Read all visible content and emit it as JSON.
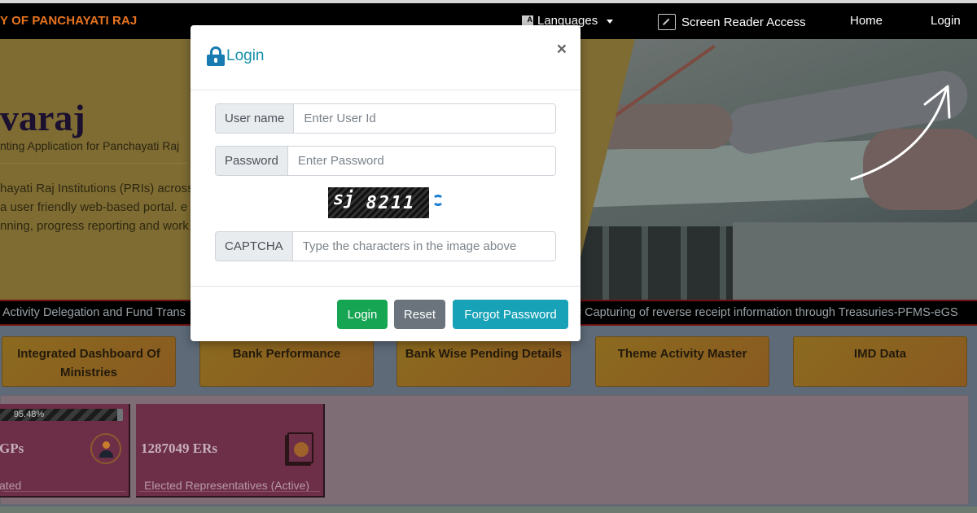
{
  "navbar": {
    "brand": "Y OF PANCHAYATI RAJ",
    "items": [
      {
        "label": "Languages",
        "icon": "language-icon",
        "has_dropdown": true
      },
      {
        "label": "Screen Reader Access",
        "icon": "screen-reader-icon"
      },
      {
        "label": "Home"
      },
      {
        "label": "Login"
      }
    ]
  },
  "hero": {
    "title": "varaj",
    "subtitle": "nting Application for Panchayati Raj",
    "description": "hayati Raj Institutions (PRIs) across\na user friendly web-based portal. e\nnning, progress reporting and work"
  },
  "ticker": {
    "items": [
      "Activity Delegation and Fund Trans",
      "# Capturing of reverse receipt information through Treasuries-PFMS-eGS"
    ]
  },
  "quick_links": [
    {
      "label": "Integrated Dashboard Of Ministries"
    },
    {
      "label": "Bank Performance"
    },
    {
      "label": "Bank Wise Pending Details"
    },
    {
      "label": "Theme Activity Master"
    },
    {
      "label": "IMD Data"
    }
  ],
  "stats": [
    {
      "progress_percent": 95.48,
      "progress_label": "95.48%",
      "value": "GPs",
      "label": "ated",
      "icon": "gram-panchayat-icon"
    },
    {
      "value": "1287049 ERs",
      "label": "Elected Representatives (Active)",
      "icon": "elected-representative-icon"
    }
  ],
  "login_modal": {
    "title": "Login",
    "close_symbol": "×",
    "username": {
      "label": "User name",
      "placeholder": "Enter User Id",
      "value": ""
    },
    "password": {
      "label": "Password",
      "placeholder": "Enter Password",
      "value": ""
    },
    "captcha": {
      "image_text_1": "sj",
      "image_text_2": "8211",
      "label": "CAPTCHA",
      "placeholder": "Type the characters in the image above",
      "value": ""
    },
    "buttons": {
      "login": "Login",
      "reset": "Reset",
      "forgot_password": "Forgot Password"
    },
    "colors": {
      "title": "#1690a8",
      "login_button": "#16a553",
      "reset_button": "#6b747c",
      "forgot_button": "#17a2b8"
    }
  }
}
